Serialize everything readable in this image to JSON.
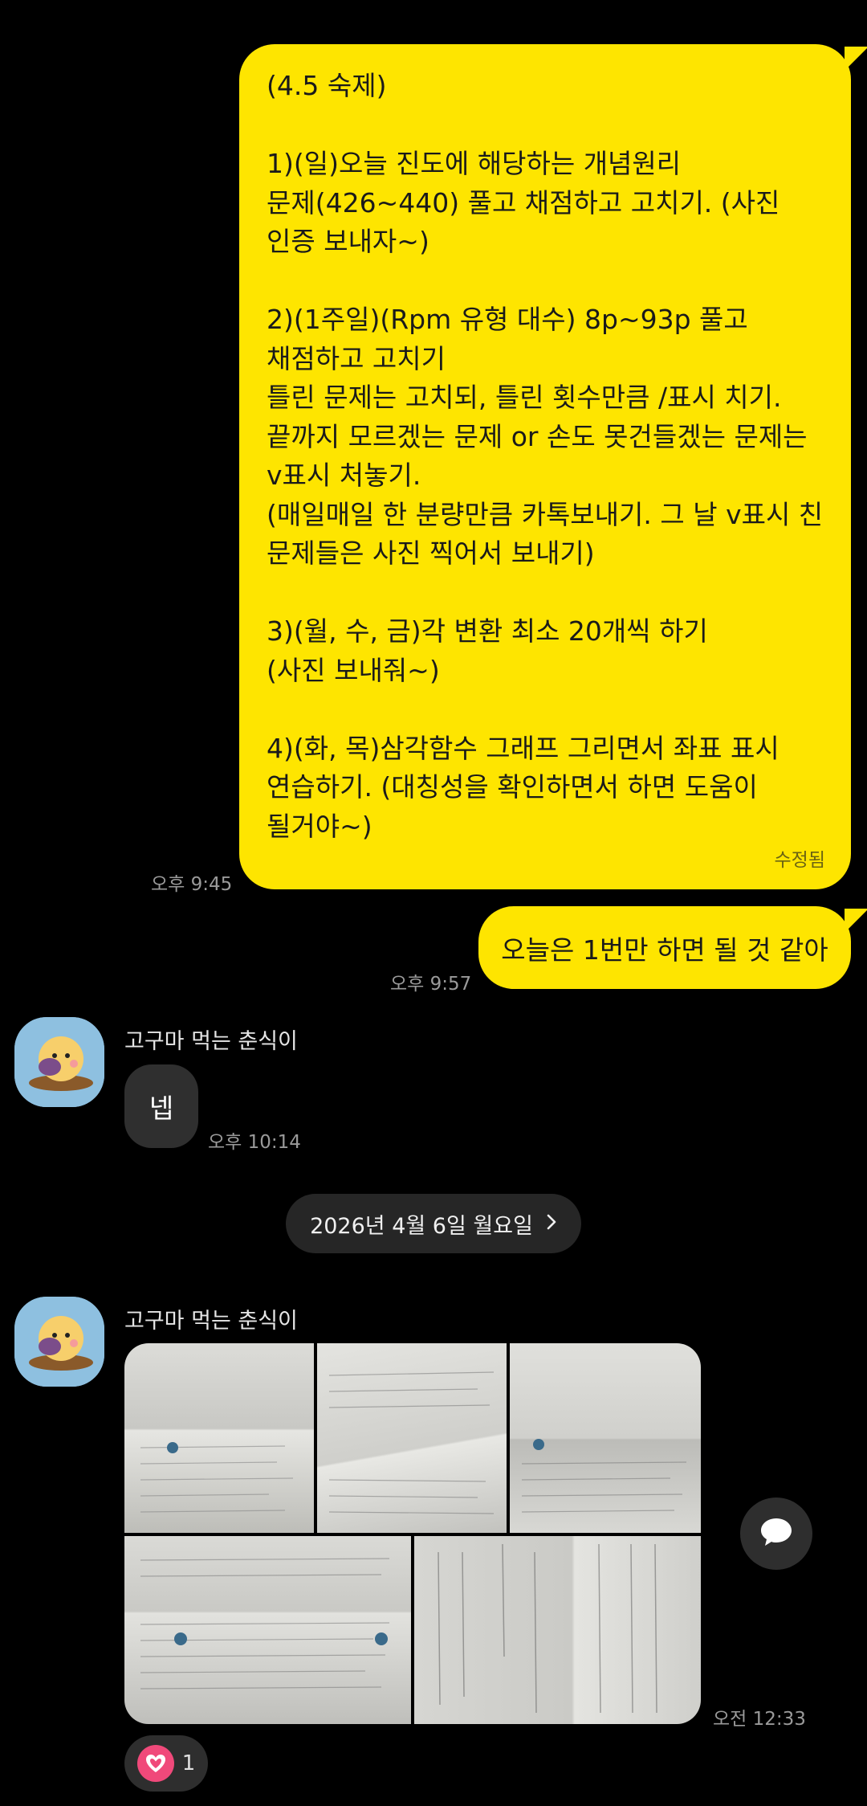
{
  "messages": {
    "homework": {
      "text": "(4.5 숙제)\n\n1)(일)오늘 진도에 해당하는 개념원리\n문제(426~440) 풀고 채점하고 고치기. (사진\n인증 보내자~)\n\n2)(1주일)(Rpm 유형 대수) 8p~93p 풀고\n채점하고 고치기\n틀린 문제는 고치되, 틀린 횟수만큼 /표시 치기.\n끝까지 모르겠는 문제 or 손도 못건들겠는 문제는\nv표시 처놓기.\n(매일매일 한 분량만큼 카톡보내기. 그 날 v표시 친\n문제들은 사진 찍어서 보내기)\n\n3)(월, 수, 금)각 변환 최소 20개씩 하기\n(사진 보내줘~)\n\n4)(화, 목)삼각함수 그래프 그리면서 좌표 표시\n연습하기. (대칭성을 확인하면서 하면 도움이\n될거야~)",
      "edited_label": "수정됨",
      "time": "오후 9:45"
    },
    "today": {
      "text": "오늘은 1번만 하면 될 것 같아",
      "time": "오후 9:57"
    },
    "reply": {
      "sender": "고구마 먹는 춘식이",
      "text": "넵",
      "time": "오후 10:14"
    },
    "date_divider": {
      "label": "2026년 4월 6일 월요일",
      "icon": "chevron-right-icon"
    },
    "photo_album": {
      "sender": "고구마 먹는 춘식이",
      "photo_count": 5,
      "time": "오전 12:33",
      "reaction": {
        "icon": "heart-icon",
        "count": "1",
        "color": "#f0497a"
      }
    }
  },
  "floating_button": {
    "icon": "chat-bubble-icon"
  },
  "colors": {
    "background": "#000000",
    "my_bubble": "#FEE500",
    "their_bubble": "#2f2f2f"
  }
}
